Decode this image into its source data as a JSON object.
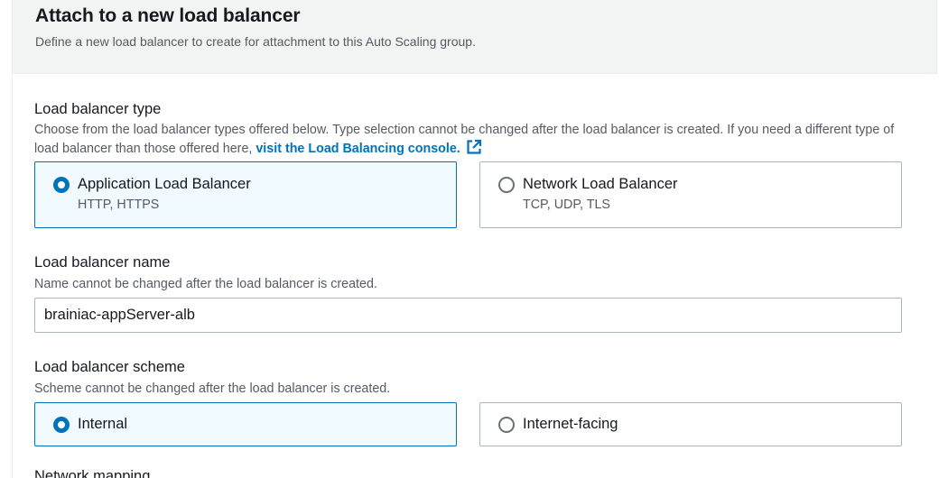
{
  "header": {
    "title": "Attach to a new load balancer",
    "description": "Define a new load balancer to create for attachment to this Auto Scaling group."
  },
  "lb_type": {
    "label": "Load balancer type",
    "description": "Choose from the load balancer types offered below. Type selection cannot be changed after the load balancer is created. If you need a different type of load balancer than those offered here,",
    "link_text": "visit the Load Balancing console.",
    "options": [
      {
        "label": "Application Load Balancer",
        "description": "HTTP, HTTPS",
        "selected": true
      },
      {
        "label": "Network Load Balancer",
        "description": "TCP, UDP, TLS",
        "selected": false
      }
    ]
  },
  "lb_name": {
    "label": "Load balancer name",
    "description": "Name cannot be changed after the load balancer is created.",
    "value": "brainiac-appServer-alb"
  },
  "lb_scheme": {
    "label": "Load balancer scheme",
    "description": "Scheme cannot be changed after the load balancer is created.",
    "options": [
      {
        "label": "Internal",
        "selected": true
      },
      {
        "label": "Internet-facing",
        "selected": false
      }
    ]
  },
  "next_section": {
    "label": "Network mapping"
  },
  "colors": {
    "accent": "#0073bb",
    "selected_bg": "#f1faff",
    "header_bg": "#f2f3f3",
    "border": "#aab7b8"
  },
  "icons": {
    "external_link": "external-link-icon"
  }
}
